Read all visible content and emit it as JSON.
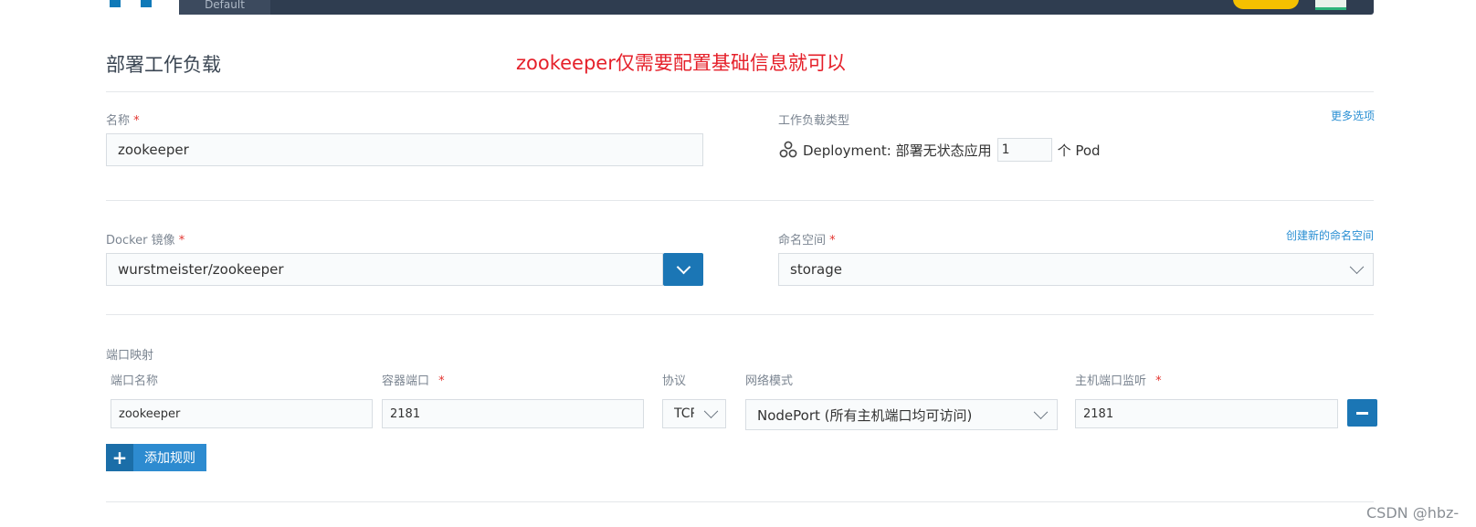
{
  "header": {
    "env_label": "Default"
  },
  "page": {
    "title": "部署工作负载",
    "annotation": "zookeeper仅需要配置基础信息就可以"
  },
  "name_field": {
    "label": "名称",
    "required_mark": "*",
    "value": "zookeeper"
  },
  "workload_type": {
    "label": "工作负载类型",
    "more_options": "更多选项",
    "icon": "deployment-icon",
    "text": "Deployment: 部署无状态应用",
    "replicas": "1",
    "suffix": "个 Pod"
  },
  "docker_image": {
    "label": "Docker 镜像",
    "required_mark": "*",
    "value": "wurstmeister/zookeeper"
  },
  "namespace": {
    "label": "命名空间",
    "required_mark": "*",
    "create_link": "创建新的命名空间",
    "value": "storage"
  },
  "port_mapping": {
    "section_label": "端口映射",
    "columns": {
      "port_name": "端口名称",
      "container_port": "容器端口",
      "protocol": "协议",
      "network_mode": "网络模式",
      "host_port": "主机端口监听"
    },
    "required_mark": "*",
    "row": {
      "port_name": "zookeeper",
      "container_port": "2181",
      "protocol": "TCP",
      "network_mode": "NodePort (所有主机端口均可访问)",
      "host_port": "2181"
    },
    "add_rule": "添加规则"
  },
  "watermark": "CSDN @hbz-"
}
